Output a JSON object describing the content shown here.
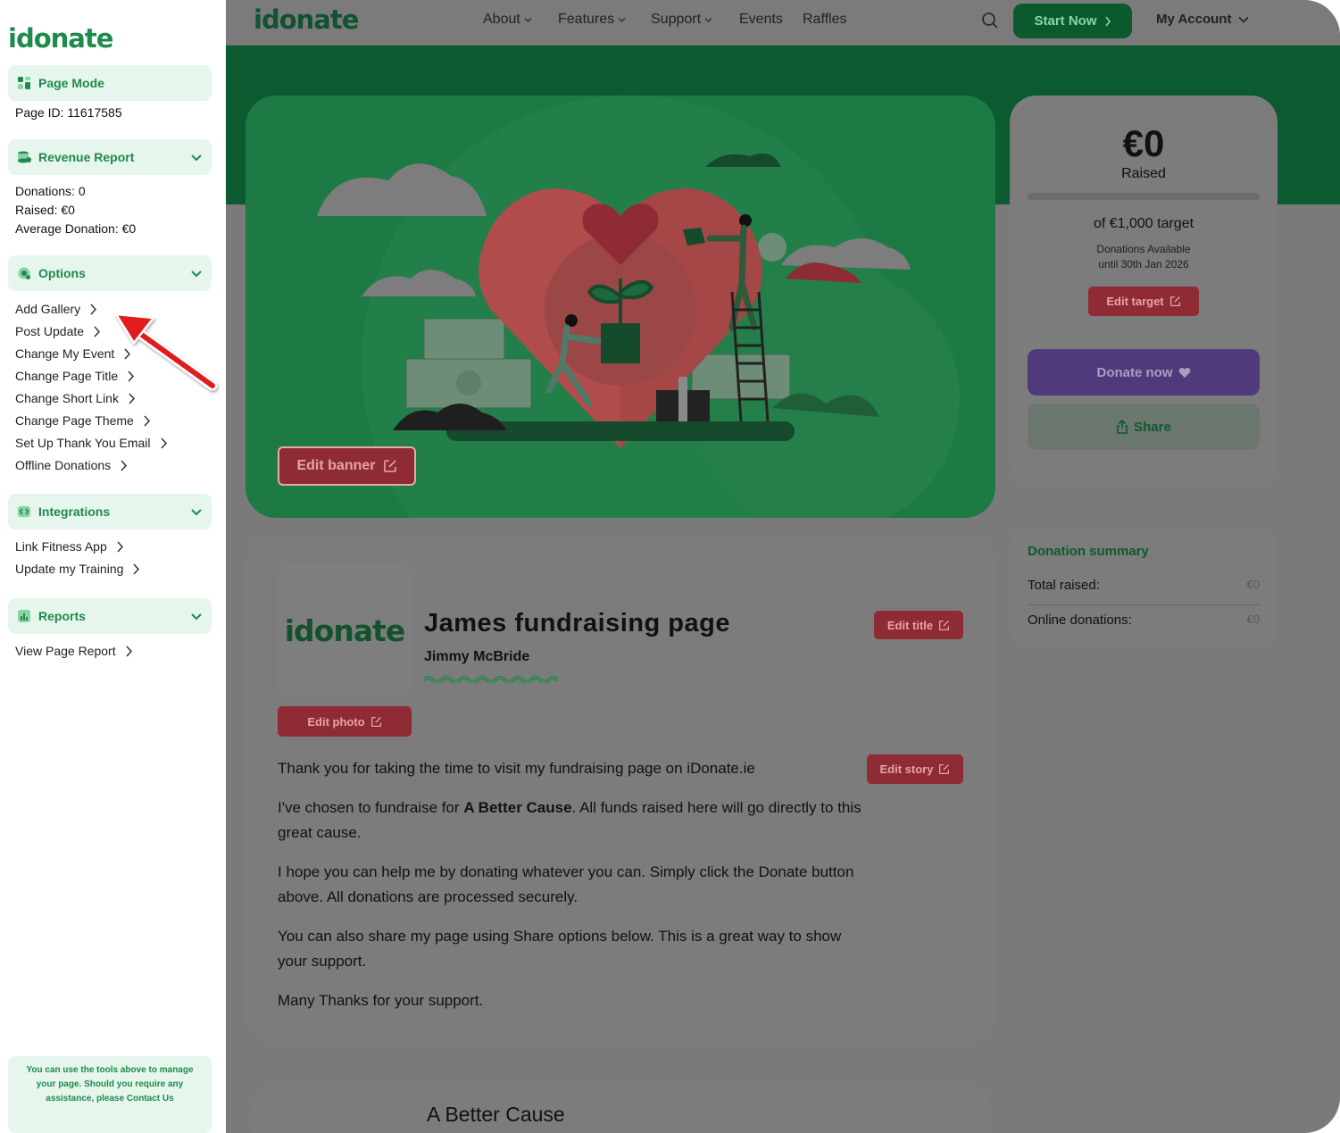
{
  "sidebar": {
    "logo": "idonate",
    "page_mode_label": "Page Mode",
    "page_id": "Page ID: 11617585",
    "revenue": {
      "label": "Revenue Report",
      "donations": "Donations: 0",
      "raised": "Raised: €0",
      "average": "Average Donation: €0"
    },
    "options": {
      "label": "Options",
      "items": [
        "Add Gallery",
        "Post Update",
        "Change My Event",
        "Change Page Title",
        "Change Short Link",
        "Change Page Theme",
        "Set Up Thank You Email",
        "Offline Donations"
      ]
    },
    "integrations": {
      "label": "Integrations",
      "items": [
        "Link Fitness App",
        "Update my Training"
      ]
    },
    "reports": {
      "label": "Reports",
      "items": [
        "View Page Report"
      ]
    },
    "help_note": "You can use the tools above to manage your page. Should you require any assistance, please Contact Us"
  },
  "topnav": {
    "logo": "idonate",
    "items": [
      "About",
      "Features",
      "Support",
      "Events",
      "Raffles"
    ],
    "start_now": "Start Now",
    "my_account": "My Account"
  },
  "hero": {
    "edit_banner": "Edit banner"
  },
  "fundraising": {
    "amount": "€0",
    "raised_label": "Raised",
    "progress_fraction": 0,
    "target": "of €1,000 target",
    "available_line1": "Donations Available",
    "available_line2": "until 30th Jan 2026",
    "edit_target": "Edit target",
    "donate_now": "Donate now",
    "share": "Share"
  },
  "summary": {
    "title": "Donation summary",
    "total_label": "Total raised:",
    "total_value": "€0",
    "online_label": "Online donations:",
    "online_value": "€0"
  },
  "page": {
    "photo_logo": "idonate",
    "title": "James fundraising page",
    "owner": "Jimmy McBride",
    "edit_title": "Edit title",
    "edit_photo": "Edit photo",
    "edit_story": "Edit story",
    "story": [
      "Thank you for taking the time to visit my fundraising page on iDonate.ie",
      "I hope you can help me by donating whatever you can. Simply click the Donate button above. All donations are processed securely.",
      "You can also share my page using Share options below. This is a great way to show your support.",
      "Many Thanks for your support."
    ],
    "story_cause_pre": "I've chosen to fundraise for ",
    "story_cause_name": "A Better Cause",
    "story_cause_post": ". All funds raised here will go directly to this great cause.",
    "cause_title": "A Better Cause"
  },
  "colors": {
    "brand_green": "#1e8a4c",
    "sidebar_tint": "#e6f6ec",
    "edit_red": "#8e2b34",
    "donate_purple": "#4f3b7c",
    "annotation_arrow": "#e01b1b"
  }
}
